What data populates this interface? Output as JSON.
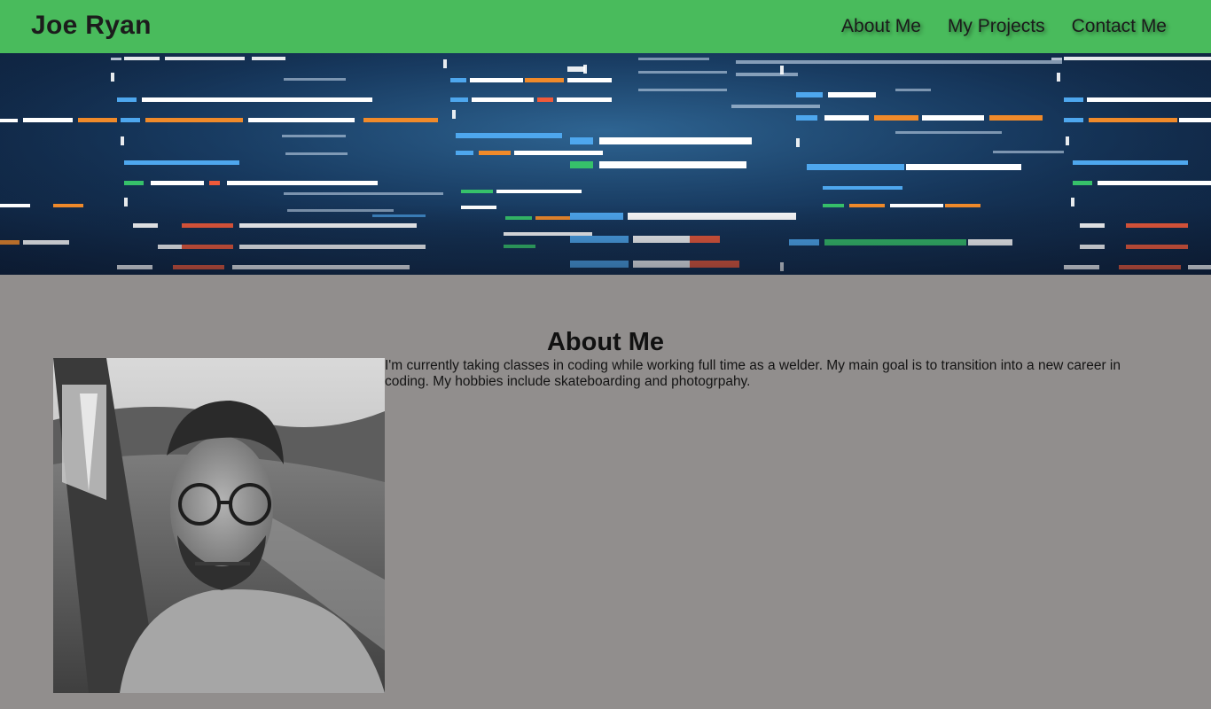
{
  "header": {
    "brand": "Joe Ryan",
    "nav": [
      {
        "label": "About Me"
      },
      {
        "label": "My Projects"
      },
      {
        "label": "Contact Me"
      }
    ],
    "bg_color": "#49bb5c"
  },
  "hero": {
    "image": "code-background-image"
  },
  "about": {
    "title": "About Me",
    "text": "I'm currently taking classes in coding while working full time as a welder. My main goal is to transition into a new career in coding. My hobbies include skateboarding and photogrpahy.",
    "photo": "profile-photo"
  },
  "page": {
    "bg_color": "#918e8d"
  }
}
